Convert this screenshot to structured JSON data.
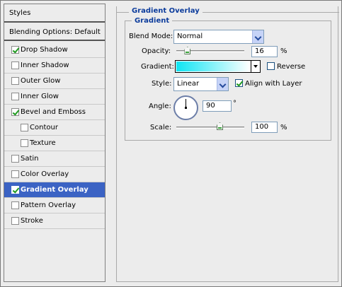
{
  "styles_panel": {
    "title": "Styles",
    "blending_default": "Blending Options: Default",
    "items": [
      {
        "label": "Drop Shadow",
        "checked": true,
        "indent": false,
        "selected": false
      },
      {
        "label": "Inner Shadow",
        "checked": false,
        "indent": false,
        "selected": false
      },
      {
        "label": "Outer Glow",
        "checked": false,
        "indent": false,
        "selected": false
      },
      {
        "label": "Inner Glow",
        "checked": false,
        "indent": false,
        "selected": false
      },
      {
        "label": "Bevel and Emboss",
        "checked": true,
        "indent": false,
        "selected": false
      },
      {
        "label": "Contour",
        "checked": false,
        "indent": true,
        "selected": false
      },
      {
        "label": "Texture",
        "checked": false,
        "indent": true,
        "selected": false
      },
      {
        "label": "Satin",
        "checked": false,
        "indent": false,
        "selected": false
      },
      {
        "label": "Color Overlay",
        "checked": false,
        "indent": false,
        "selected": false
      },
      {
        "label": "Gradient Overlay",
        "checked": true,
        "indent": false,
        "selected": true
      },
      {
        "label": "Pattern Overlay",
        "checked": false,
        "indent": false,
        "selected": false
      },
      {
        "label": "Stroke",
        "checked": false,
        "indent": false,
        "selected": false
      }
    ]
  },
  "gradient_overlay": {
    "group_title": "Gradient Overlay",
    "sub_title": "Gradient",
    "blend_mode_label": "Blend Mode:",
    "blend_mode_value": "Normal",
    "opacity_label": "Opacity:",
    "opacity_value": "16",
    "opacity_fraction": 0.16,
    "opacity_unit": "%",
    "gradient_label": "Gradient:",
    "gradient_colors": [
      "#0ee5f3",
      "#ffffff"
    ],
    "reverse_label": "Reverse",
    "reverse_checked": false,
    "style_label": "Style:",
    "style_value": "Linear",
    "align_label": "Align with Layer",
    "align_checked": true,
    "angle_label": "Angle:",
    "angle_value": "90",
    "angle_unit": "°",
    "scale_label": "Scale:",
    "scale_value": "100",
    "scale_unit": "%"
  },
  "colors": {
    "selection": "#3b63c4",
    "group_title": "#0c3c9c",
    "check_mark": "#1f9a1f"
  },
  "icons": {
    "checkbox": "checkbox-icon",
    "dropdown": "chevron-down-icon",
    "angle_dial": "angle-dial-icon",
    "slider_thumb": "slider-thumb-icon"
  }
}
